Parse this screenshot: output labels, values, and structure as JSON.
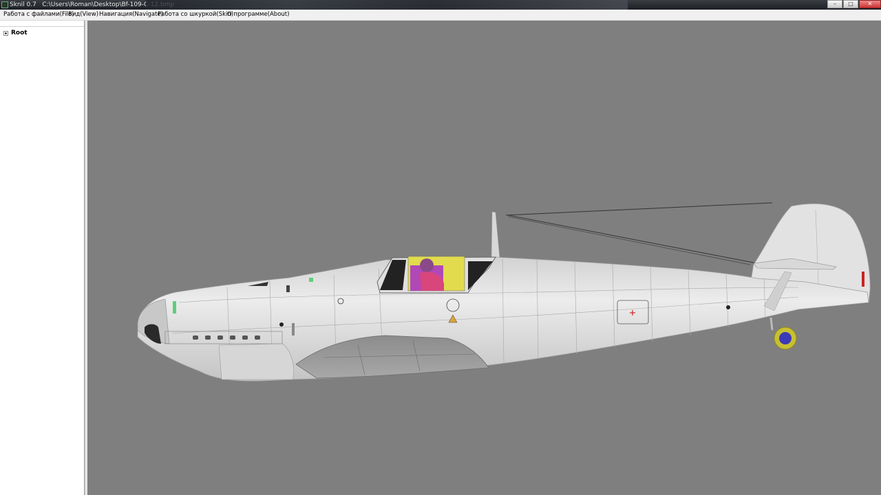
{
  "window": {
    "title": "Sknil 0.7   C:\\Users\\Roman\\Desktop\\Bf-109-C-12.bmp",
    "minimize_label": "–",
    "maximize_label": "□",
    "close_label": "✕"
  },
  "menu": {
    "items": [
      {
        "label": "Работа с файлами(File)"
      },
      {
        "label": "Вид(View)"
      },
      {
        "label": "Навигация(Navigate)"
      },
      {
        "label": "Работа со шкуркой(Skin)"
      },
      {
        "label": "О программе(About)"
      }
    ]
  },
  "tree": {
    "root_label": "Root"
  },
  "viewport": {
    "background_color": "#7f7f7f",
    "model_color": "#e4e4e4",
    "canopy_highlight_colors": [
      "#e2db4d",
      "#b048b8",
      "#d8467c"
    ],
    "marker_color": "#cc2222",
    "nav_widget_color": "#c8c030"
  }
}
